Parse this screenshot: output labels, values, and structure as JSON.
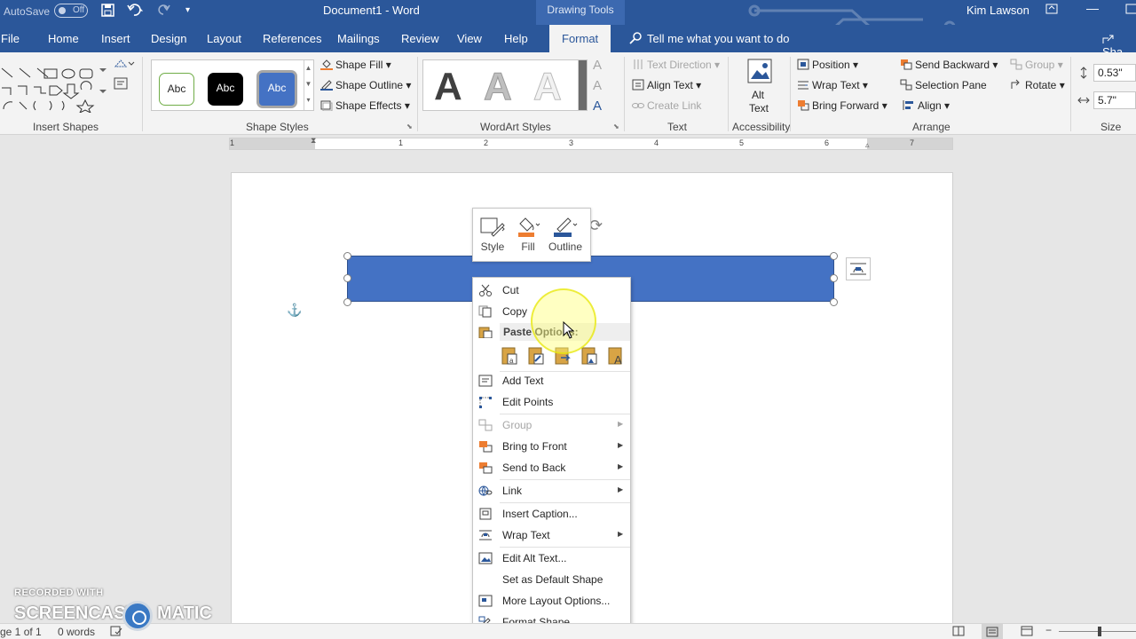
{
  "titlebar": {
    "autosave_label": "AutoSave",
    "autosave_state": "Off",
    "doc_title": "Document1  -  Word",
    "context_tab_group": "Drawing Tools",
    "user_name": "Kim Lawson"
  },
  "tabs": [
    {
      "label": "File"
    },
    {
      "label": "Home"
    },
    {
      "label": "Insert"
    },
    {
      "label": "Design"
    },
    {
      "label": "Layout"
    },
    {
      "label": "References"
    },
    {
      "label": "Mailings"
    },
    {
      "label": "Review"
    },
    {
      "label": "View"
    },
    {
      "label": "Help"
    },
    {
      "label": "Format"
    }
  ],
  "tell_me": "Tell me what you want to do",
  "share": "Sha",
  "ribbon": {
    "groups": {
      "insert_shapes": "Insert Shapes",
      "shape_styles": "Shape Styles",
      "wordart_styles": "WordArt Styles",
      "text": "Text",
      "accessibility": "Accessibility",
      "arrange": "Arrange",
      "size": "Size"
    },
    "style_presets": [
      "Abc",
      "Abc",
      "Abc"
    ],
    "wordart_letters": [
      "A",
      "A",
      "A"
    ],
    "shape_fill": "Shape Fill",
    "shape_outline": "Shape Outline",
    "shape_effects": "Shape Effects",
    "text_direction": "Text Direction",
    "align_text": "Align Text",
    "create_link": "Create Link",
    "alt_text_1": "Alt",
    "alt_text_2": "Text",
    "position": "Position",
    "wrap_text": "Wrap Text",
    "bring_forward": "Bring Forward",
    "send_backward": "Send Backward",
    "selection_pane": "Selection Pane",
    "align": "Align",
    "group": "Group",
    "rotate": "Rotate",
    "height_value": "0.53\"",
    "width_value": "5.7\""
  },
  "ruler_numbers": [
    "1",
    "1",
    "2",
    "3",
    "4",
    "5",
    "6",
    "7"
  ],
  "mini_toolbar": {
    "style": "Style",
    "fill": "Fill",
    "outline": "Outline"
  },
  "context_menu": {
    "cut": "Cut",
    "copy": "Copy",
    "paste_options": "Paste Options:",
    "add_text": "Add Text",
    "edit_points": "Edit Points",
    "group": "Group",
    "bring_to_front": "Bring to Front",
    "send_to_back": "Send to Back",
    "link": "Link",
    "insert_caption": "Insert Caption...",
    "wrap_text": "Wrap Text",
    "edit_alt_text": "Edit Alt Text...",
    "set_default_shape": "Set as Default Shape",
    "more_layout_options": "More Layout Options...",
    "format_shape": "Format Shape..."
  },
  "status": {
    "page": "ge 1 of 1",
    "words": "0 words"
  },
  "watermark": {
    "top": "RECORDED WITH",
    "left": "SCREENCAST",
    "right": "MATIC"
  },
  "colors": {
    "word_blue": "#2b579a",
    "shape_fill": "#4472c4",
    "fill_orange": "#ed7d31"
  }
}
